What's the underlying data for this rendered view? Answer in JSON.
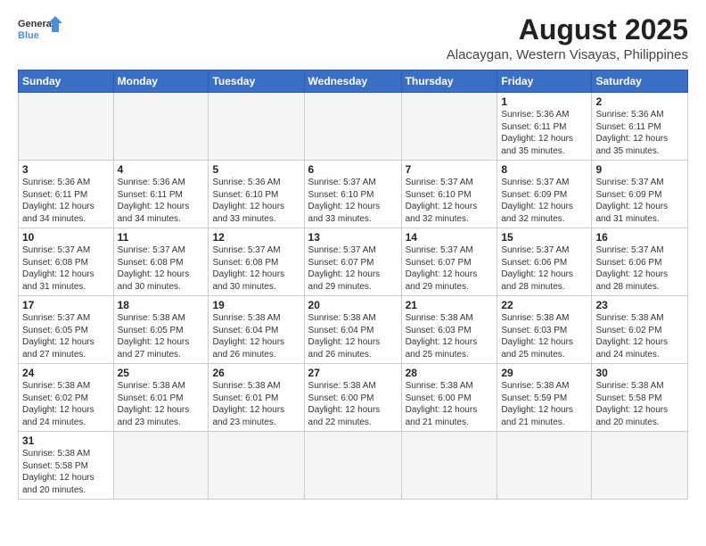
{
  "logo": {
    "text_general": "General",
    "text_blue": "Blue"
  },
  "title": "August 2025",
  "subtitle": "Alacaygan, Western Visayas, Philippines",
  "days_of_week": [
    "Sunday",
    "Monday",
    "Tuesday",
    "Wednesday",
    "Thursday",
    "Friday",
    "Saturday"
  ],
  "weeks": [
    [
      {
        "day": "",
        "info": ""
      },
      {
        "day": "",
        "info": ""
      },
      {
        "day": "",
        "info": ""
      },
      {
        "day": "",
        "info": ""
      },
      {
        "day": "",
        "info": ""
      },
      {
        "day": "1",
        "info": "Sunrise: 5:36 AM\nSunset: 6:11 PM\nDaylight: 12 hours\nand 35 minutes."
      },
      {
        "day": "2",
        "info": "Sunrise: 5:36 AM\nSunset: 6:11 PM\nDaylight: 12 hours\nand 35 minutes."
      }
    ],
    [
      {
        "day": "3",
        "info": "Sunrise: 5:36 AM\nSunset: 6:11 PM\nDaylight: 12 hours\nand 34 minutes."
      },
      {
        "day": "4",
        "info": "Sunrise: 5:36 AM\nSunset: 6:11 PM\nDaylight: 12 hours\nand 34 minutes."
      },
      {
        "day": "5",
        "info": "Sunrise: 5:36 AM\nSunset: 6:10 PM\nDaylight: 12 hours\nand 33 minutes."
      },
      {
        "day": "6",
        "info": "Sunrise: 5:37 AM\nSunset: 6:10 PM\nDaylight: 12 hours\nand 33 minutes."
      },
      {
        "day": "7",
        "info": "Sunrise: 5:37 AM\nSunset: 6:10 PM\nDaylight: 12 hours\nand 32 minutes."
      },
      {
        "day": "8",
        "info": "Sunrise: 5:37 AM\nSunset: 6:09 PM\nDaylight: 12 hours\nand 32 minutes."
      },
      {
        "day": "9",
        "info": "Sunrise: 5:37 AM\nSunset: 6:09 PM\nDaylight: 12 hours\nand 31 minutes."
      }
    ],
    [
      {
        "day": "10",
        "info": "Sunrise: 5:37 AM\nSunset: 6:08 PM\nDaylight: 12 hours\nand 31 minutes."
      },
      {
        "day": "11",
        "info": "Sunrise: 5:37 AM\nSunset: 6:08 PM\nDaylight: 12 hours\nand 30 minutes."
      },
      {
        "day": "12",
        "info": "Sunrise: 5:37 AM\nSunset: 6:08 PM\nDaylight: 12 hours\nand 30 minutes."
      },
      {
        "day": "13",
        "info": "Sunrise: 5:37 AM\nSunset: 6:07 PM\nDaylight: 12 hours\nand 29 minutes."
      },
      {
        "day": "14",
        "info": "Sunrise: 5:37 AM\nSunset: 6:07 PM\nDaylight: 12 hours\nand 29 minutes."
      },
      {
        "day": "15",
        "info": "Sunrise: 5:37 AM\nSunset: 6:06 PM\nDaylight: 12 hours\nand 28 minutes."
      },
      {
        "day": "16",
        "info": "Sunrise: 5:37 AM\nSunset: 6:06 PM\nDaylight: 12 hours\nand 28 minutes."
      }
    ],
    [
      {
        "day": "17",
        "info": "Sunrise: 5:37 AM\nSunset: 6:05 PM\nDaylight: 12 hours\nand 27 minutes."
      },
      {
        "day": "18",
        "info": "Sunrise: 5:38 AM\nSunset: 6:05 PM\nDaylight: 12 hours\nand 27 minutes."
      },
      {
        "day": "19",
        "info": "Sunrise: 5:38 AM\nSunset: 6:04 PM\nDaylight: 12 hours\nand 26 minutes."
      },
      {
        "day": "20",
        "info": "Sunrise: 5:38 AM\nSunset: 6:04 PM\nDaylight: 12 hours\nand 26 minutes."
      },
      {
        "day": "21",
        "info": "Sunrise: 5:38 AM\nSunset: 6:03 PM\nDaylight: 12 hours\nand 25 minutes."
      },
      {
        "day": "22",
        "info": "Sunrise: 5:38 AM\nSunset: 6:03 PM\nDaylight: 12 hours\nand 25 minutes."
      },
      {
        "day": "23",
        "info": "Sunrise: 5:38 AM\nSunset: 6:02 PM\nDaylight: 12 hours\nand 24 minutes."
      }
    ],
    [
      {
        "day": "24",
        "info": "Sunrise: 5:38 AM\nSunset: 6:02 PM\nDaylight: 12 hours\nand 24 minutes."
      },
      {
        "day": "25",
        "info": "Sunrise: 5:38 AM\nSunset: 6:01 PM\nDaylight: 12 hours\nand 23 minutes."
      },
      {
        "day": "26",
        "info": "Sunrise: 5:38 AM\nSunset: 6:01 PM\nDaylight: 12 hours\nand 23 minutes."
      },
      {
        "day": "27",
        "info": "Sunrise: 5:38 AM\nSunset: 6:00 PM\nDaylight: 12 hours\nand 22 minutes."
      },
      {
        "day": "28",
        "info": "Sunrise: 5:38 AM\nSunset: 6:00 PM\nDaylight: 12 hours\nand 21 minutes."
      },
      {
        "day": "29",
        "info": "Sunrise: 5:38 AM\nSunset: 5:59 PM\nDaylight: 12 hours\nand 21 minutes."
      },
      {
        "day": "30",
        "info": "Sunrise: 5:38 AM\nSunset: 5:58 PM\nDaylight: 12 hours\nand 20 minutes."
      }
    ],
    [
      {
        "day": "31",
        "info": "Sunrise: 5:38 AM\nSunset: 5:58 PM\nDaylight: 12 hours\nand 20 minutes."
      },
      {
        "day": "",
        "info": ""
      },
      {
        "day": "",
        "info": ""
      },
      {
        "day": "",
        "info": ""
      },
      {
        "day": "",
        "info": ""
      },
      {
        "day": "",
        "info": ""
      },
      {
        "day": "",
        "info": ""
      }
    ]
  ]
}
